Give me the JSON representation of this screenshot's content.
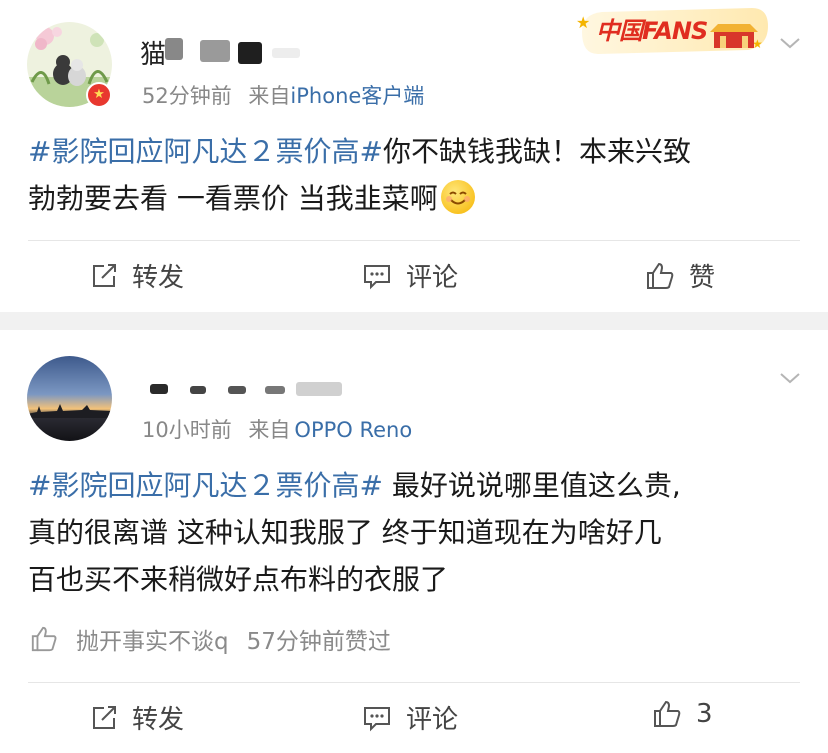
{
  "posts": [
    {
      "user": {
        "name_visible": "猫"
      },
      "meta": {
        "time": "52分钟前",
        "from_label": "来自",
        "source": "iPhone客户端"
      },
      "badge_text": "中国FANS",
      "content": {
        "hashtag": "#影院回应阿凡达２票价高#",
        "text1": "你不缺钱我缺！本来兴致",
        "text2": "勃勃要去看 一看票价 当我韭菜啊"
      },
      "actions": {
        "repost": "转发",
        "comment": "评论",
        "like": "赞"
      }
    },
    {
      "meta": {
        "time": "10小时前",
        "from_label": "来自",
        "source": "OPPO Reno"
      },
      "content": {
        "hashtag": "#影院回应阿凡达２票价高#",
        "text1": " 最好说说哪里值这么贵,",
        "text2": "真的很离谱  这种认知我服了  终于知道现在为啥好几",
        "text3": "百也买不来稍微好点布料的衣服了"
      },
      "liked_by": {
        "user": "抛开事实不谈q",
        "note": "57分钟前赞过"
      },
      "actions": {
        "repost": "转发",
        "comment": "评论",
        "like_count": "3"
      }
    }
  ]
}
